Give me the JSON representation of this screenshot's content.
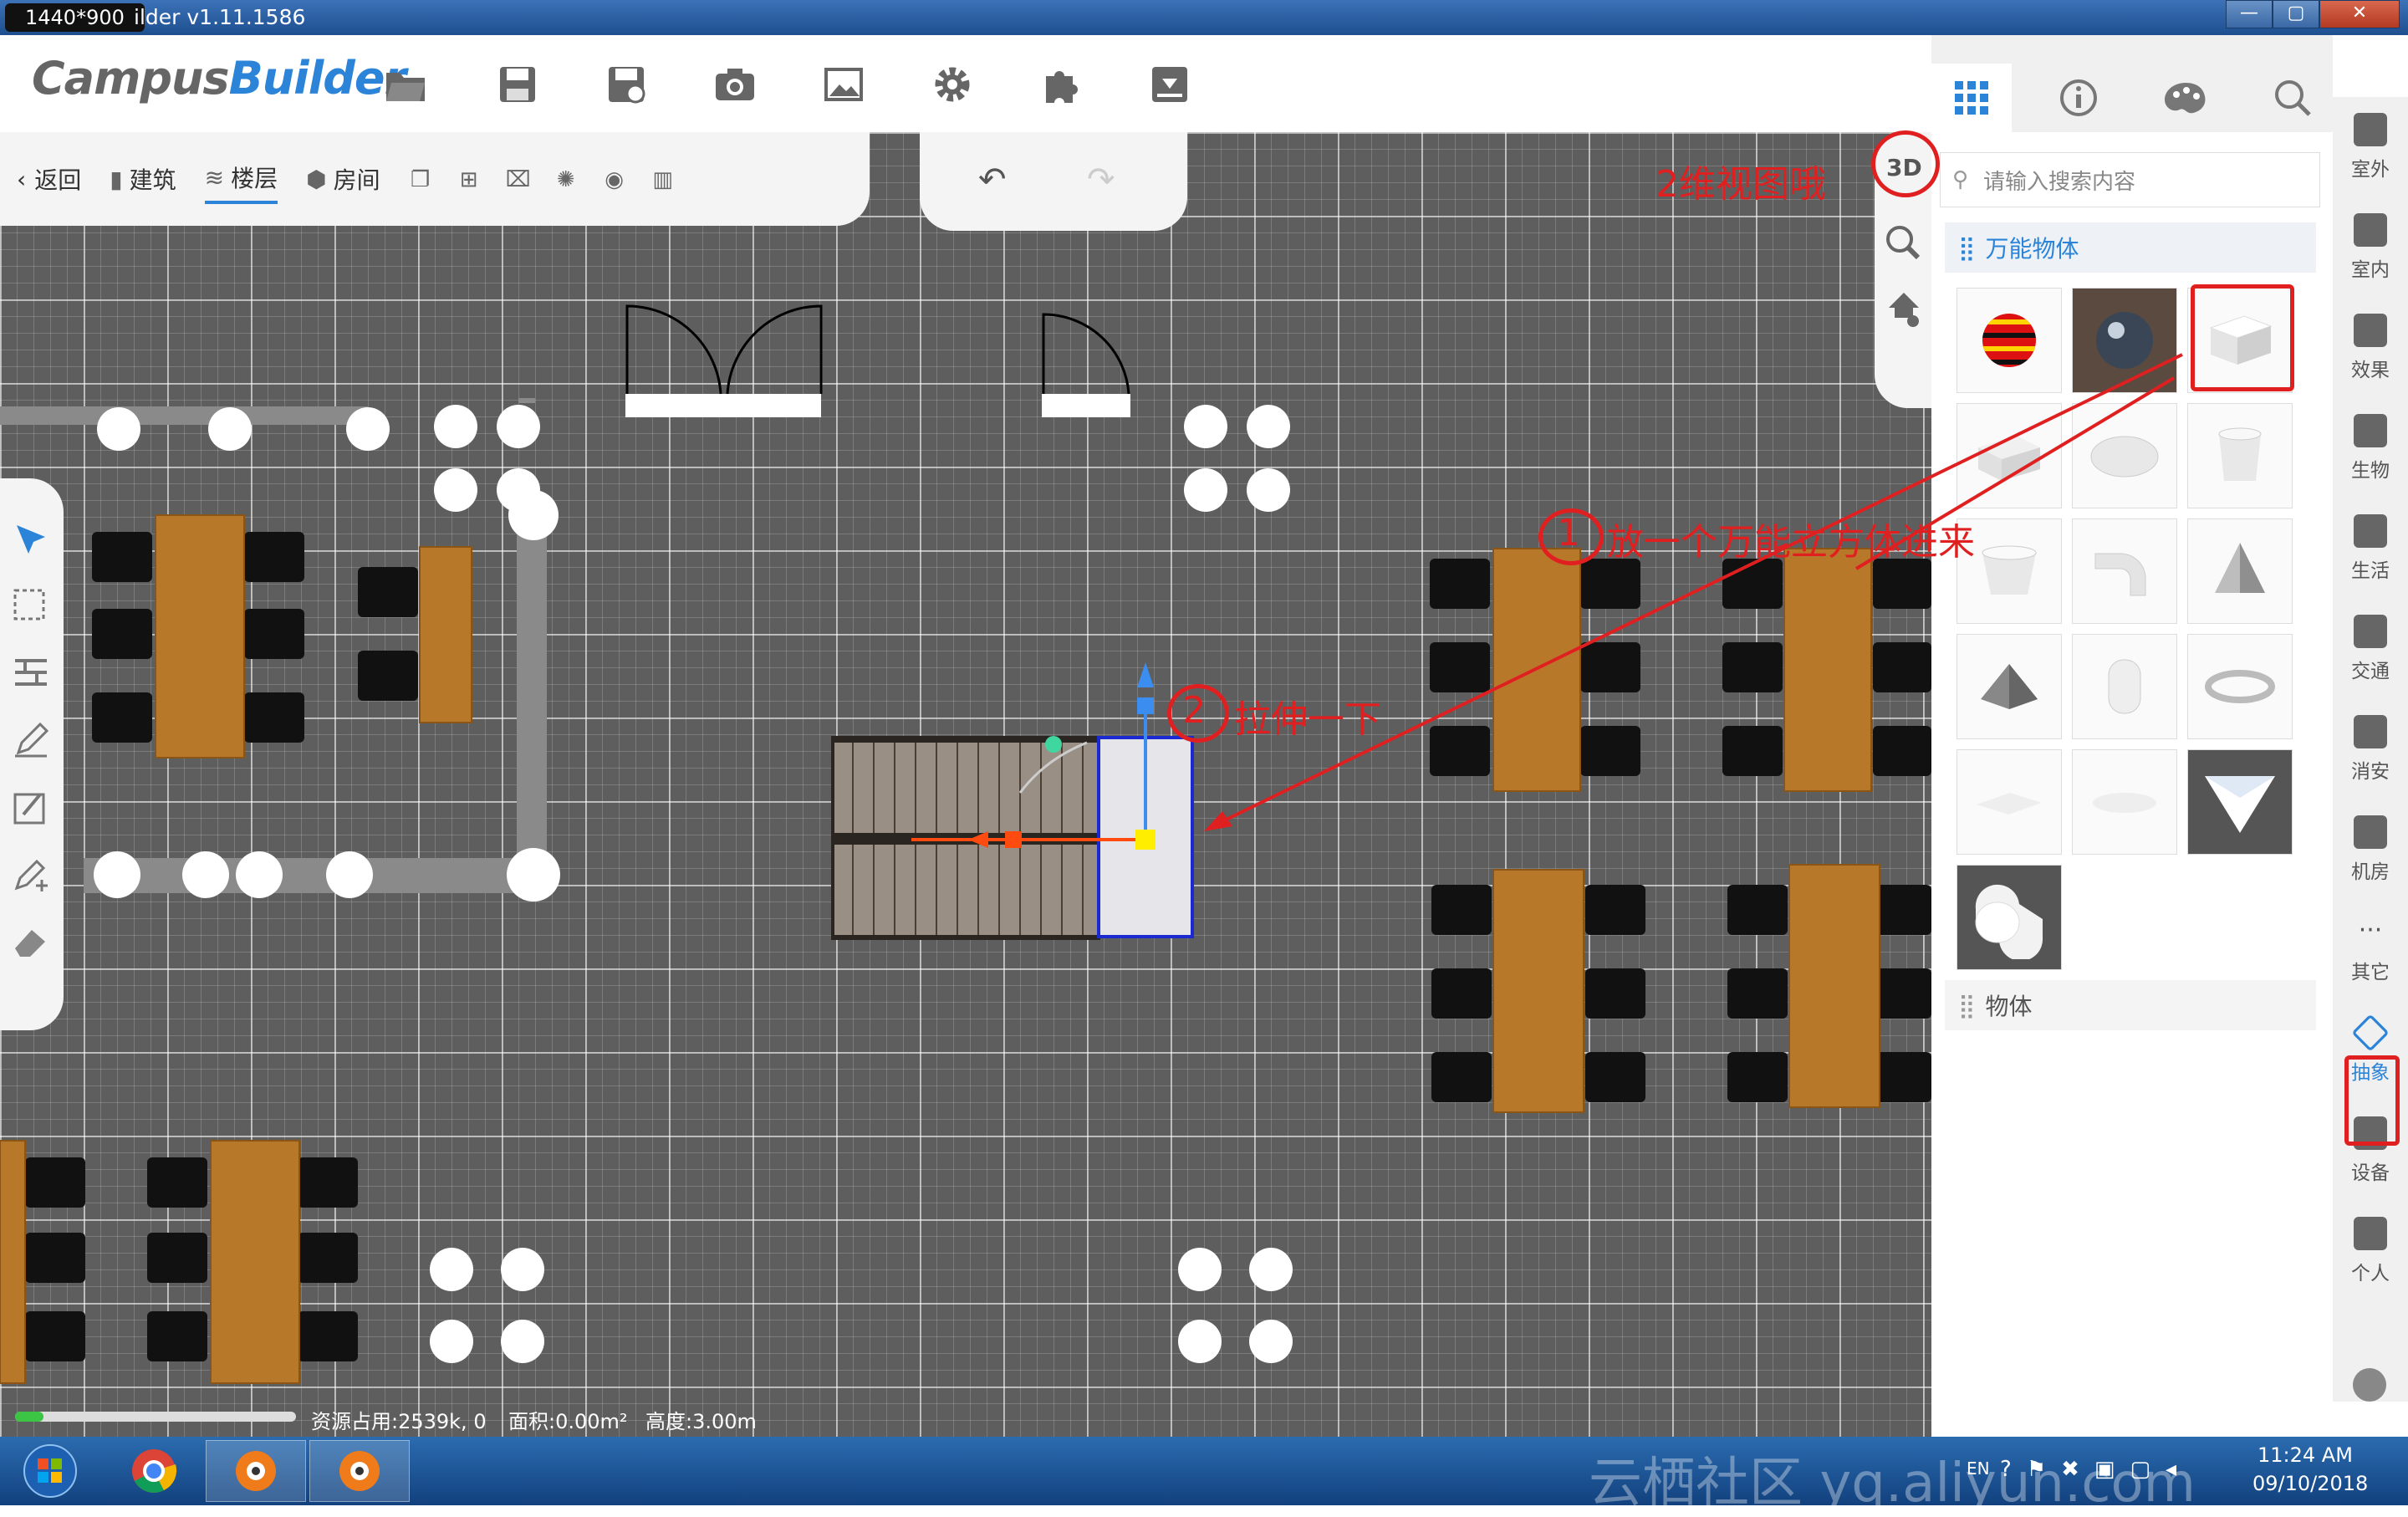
{
  "window": {
    "resolution": "1440*900",
    "title": "ilder v1.11.1586",
    "buttons": [
      "—",
      "▢",
      "✕"
    ]
  },
  "app": {
    "logo_a": "Campus",
    "logo_b": "Builder"
  },
  "toolbar": {
    "icons": [
      "folder-open-icon",
      "save-icon",
      "save-as-icon",
      "camera-icon",
      "image-icon",
      "gear-icon",
      "puzzle-icon",
      "download-icon"
    ]
  },
  "subbar": {
    "back": "返回",
    "building": "建筑",
    "floor": "楼层",
    "room": "房间"
  },
  "viewtools": {
    "toggle_3d": "3D"
  },
  "status": {
    "resources": "资源占用:2539k, 0",
    "area": "面积:0.00m²",
    "height": "高度:3.00m",
    "progress": 0.1
  },
  "panel": {
    "search_placeholder": "请输入搜索内容",
    "category_1": "万能物体",
    "category_2": "物体"
  },
  "rail": {
    "items": [
      "室外",
      "室内",
      "效果",
      "生物",
      "生活",
      "交通",
      "消安",
      "机房",
      "其它",
      "抽象",
      "设备",
      "个人"
    ]
  },
  "annotations": {
    "note_2d": "2维视图哦",
    "step1_num": "1",
    "step1": "放一个万能立方体进来",
    "step2_num": "2",
    "step2": "拉伸一下"
  },
  "taskbar": {
    "lang": "EN",
    "time": "11:24 AM",
    "date": "09/10/2018",
    "watermark": "云栖社区 yq.aliyun.com"
  },
  "colors": {
    "accent": "#2c84d8",
    "annotation": "#e02020",
    "canvas": "#5e5e5e"
  }
}
